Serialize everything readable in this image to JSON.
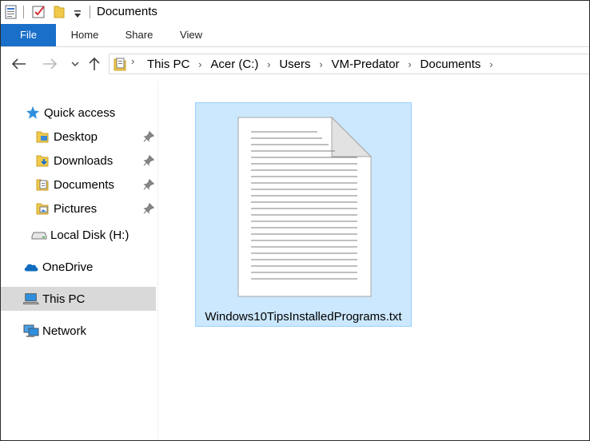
{
  "window": {
    "title": "Documents"
  },
  "ribbon": {
    "tabs": [
      {
        "label": "File",
        "active": true
      },
      {
        "label": "Home"
      },
      {
        "label": "Share"
      },
      {
        "label": "View"
      }
    ]
  },
  "address": {
    "crumbs": [
      "This PC",
      "Acer (C:)",
      "Users",
      "VM-Predator",
      "Documents"
    ]
  },
  "nav": {
    "quick_access": "Quick access",
    "items": [
      {
        "label": "Desktop",
        "icon": "desktop-folder-icon",
        "pinned": true
      },
      {
        "label": "Downloads",
        "icon": "downloads-folder-icon",
        "pinned": true
      },
      {
        "label": "Documents",
        "icon": "documents-folder-icon",
        "pinned": true
      },
      {
        "label": "Pictures",
        "icon": "pictures-folder-icon",
        "pinned": true
      }
    ],
    "local_disk": "Local Disk (H:)",
    "onedrive": "OneDrive",
    "this_pc": "This PC",
    "network": "Network"
  },
  "files": [
    {
      "name": "Windows10TipsInstalledPrograms.txt",
      "icon": "text-document-icon",
      "selected": true
    }
  ],
  "colors": {
    "accent": "#1a6fc9",
    "selection": "#cce8ff",
    "selection_border": "#99d1ff",
    "nav_selected": "#d9d9d9"
  }
}
